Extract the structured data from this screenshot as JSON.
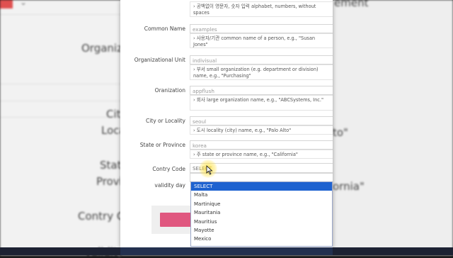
{
  "background": {
    "left_labels": [
      "Organizat",
      "City",
      "Locali",
      "Stat",
      "Provin",
      "Contry C",
      "validity"
    ],
    "right_labels": [
      "ement",
      "to\"",
      "ornia\""
    ]
  },
  "form": {
    "fields": [
      {
        "label": "",
        "value": "",
        "hint": "› 공백없이 영문자, 숫자 입력 alphabet, numbers, without spaces"
      },
      {
        "label": "Common Name",
        "value": "examples",
        "hint": "› 사용자/기관 common name of a person, e.g., \"Susan Jones\""
      },
      {
        "label": "Organizational Unit",
        "value": "indivisual",
        "hint": "› 부서 small organization (e.g. department or division) name, e.g., \"Purchasing\""
      },
      {
        "label": "Oranization",
        "value": "appflush",
        "hint": "› 회사 large organization name, e.g., \"ABCSystems, Inc.\""
      },
      {
        "label": "City or Locality",
        "value": "seoul",
        "hint": "› 도시 locality (city) name, e.g., \"Palo Alto\""
      },
      {
        "label": "State or Province",
        "value": "korea",
        "hint": "› 주 state or province name, e.g., \"California\""
      }
    ],
    "country_label": "Contry Code",
    "country_value": "SELECT",
    "validity_label": "validity day"
  },
  "dropdown": {
    "options": [
      "SELECT",
      "Malta",
      "Martinique",
      "Mauritania",
      "Mauritius",
      "Mayotte",
      "Mexico"
    ],
    "selected": "SELECT"
  },
  "colors": {
    "selected_option": "#1e62d0",
    "submit_button": "#e0577f"
  }
}
